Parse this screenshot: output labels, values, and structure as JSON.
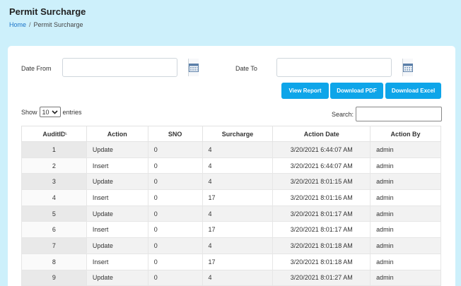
{
  "header": {
    "title": "Permit Surcharge",
    "breadcrumb_home": "Home",
    "breadcrumb_sep": "/",
    "breadcrumb_current": "Permit Surcharge"
  },
  "filters": {
    "date_from_label": "Date From",
    "date_from_value": "",
    "date_to_label": "Date To",
    "date_to_value": ""
  },
  "buttons": {
    "view_report": "View Report",
    "download_pdf": "Download PDF",
    "download_excel": "Download Excel"
  },
  "table_controls": {
    "show_label": "Show",
    "entries_value": "10",
    "entries_label": "entries",
    "search_label": "Search:",
    "search_value": ""
  },
  "table": {
    "columns": [
      "AuditID",
      "Action",
      "SNO",
      "Surcharge",
      "Action Date",
      "Action By"
    ],
    "rows": [
      [
        "1",
        "Update",
        "0",
        "4",
        "3/20/2021 6:44:07 AM",
        "admin"
      ],
      [
        "2",
        "Insert",
        "0",
        "4",
        "3/20/2021 6:44:07 AM",
        "admin"
      ],
      [
        "3",
        "Update",
        "0",
        "4",
        "3/20/2021 8:01:15 AM",
        "admin"
      ],
      [
        "4",
        "Insert",
        "0",
        "17",
        "3/20/2021 8:01:16 AM",
        "admin"
      ],
      [
        "5",
        "Update",
        "0",
        "4",
        "3/20/2021 8:01:17 AM",
        "admin"
      ],
      [
        "6",
        "Insert",
        "0",
        "17",
        "3/20/2021 8:01:17 AM",
        "admin"
      ],
      [
        "7",
        "Update",
        "0",
        "4",
        "3/20/2021 8:01:18 AM",
        "admin"
      ],
      [
        "8",
        "Insert",
        "0",
        "17",
        "3/20/2021 8:01:18 AM",
        "admin"
      ],
      [
        "9",
        "Update",
        "0",
        "4",
        "3/20/2021 8:01:27 AM",
        "admin"
      ]
    ]
  },
  "colors": {
    "page_background": "#cdf0fb",
    "button_accent": "#0ea5e9",
    "link": "#1a73c8"
  }
}
